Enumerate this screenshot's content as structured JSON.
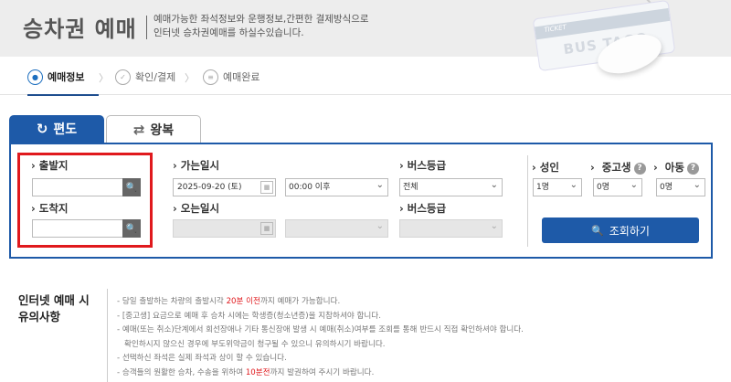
{
  "header": {
    "title": "승차권 예매",
    "desc_line1": "예매가능한 좌석정보와 운행정보,간편한 결제방식으로",
    "desc_line2": "인터넷 승차권예매를 하실수있습니다.",
    "card_ticket": "TICKET",
    "card_brand": "BUS TAGO"
  },
  "steps": [
    {
      "label": "예매정보"
    },
    {
      "label": "확인/결제"
    },
    {
      "label": "예매완료"
    }
  ],
  "tabs": {
    "oneway": "편도",
    "round": "왕복"
  },
  "form": {
    "departure_label": "출발지",
    "arrival_label": "도착지",
    "go_date_label": "가는일시",
    "go_date_value": "2025-09-20 (토)",
    "go_time_value": "00:00 이후",
    "return_date_label": "오는일시",
    "bus_class_label": "버스등급",
    "bus_class_value": "전체",
    "bus_class2_label": "버스등급",
    "adult_label": "성인",
    "adult_value": "1명",
    "student_label": "중고생",
    "student_value": "0명",
    "child_label": "아동",
    "child_value": "0명",
    "search_button": "조회하기"
  },
  "notice": {
    "title_line1": "인터넷 예매 시",
    "title_line2": "유의사항",
    "items": [
      {
        "pre": "당일 출발하는 차량의 출발시각 ",
        "red": "20분 이전",
        "post": "까지 예매가 가능합니다."
      },
      {
        "pre": "[중고생] 요금으로 예매 후 승차 시에는 학생증(청소년증)을 지참하셔야 합니다.",
        "red": "",
        "post": ""
      },
      {
        "pre": "예매(또는 취소)단계에서 회선장애나 기타 통신장애 발생 시 예매(취소)여부를 조회를 통해 반드시 직접 확인하셔야 합니다.",
        "red": "",
        "post": ""
      },
      {
        "pre": "확인하시지 않으신 경우에 부도위약금이 청구될 수 있으니 유의하시기 바랍니다.",
        "red": "",
        "post": ""
      },
      {
        "pre": "선택하신 좌석은 실제 좌석과 상이 할 수 있습니다.",
        "red": "",
        "post": ""
      },
      {
        "pre": "승객들의 원활한 승차, 수송을 위하여 ",
        "red": "10분전",
        "post": "까지 발권하여 주시기 바랍니다."
      }
    ]
  },
  "colors": {
    "primary": "#1e5aa8",
    "highlight": "#e0191d"
  }
}
